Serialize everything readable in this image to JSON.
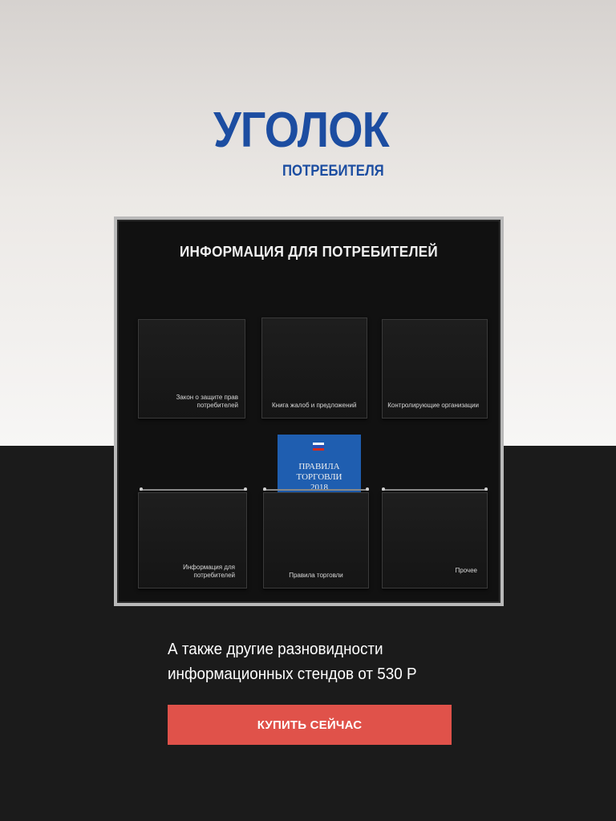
{
  "header": {
    "logo_title": "УГОЛОК",
    "logo_subtitle": "ПОТРЕБИТЕЛЯ"
  },
  "stand": {
    "title": "ИНФОРМАЦИЯ ДЛЯ ПОТРЕБИТЕЛЕЙ",
    "pockets_top": [
      {
        "label": "Закон о защите прав потребителей"
      },
      {
        "label": "Книга жалоб и предложений"
      },
      {
        "label": "Контролирующие организации"
      }
    ],
    "pockets_bottom": [
      {
        "label": "Информация для потребителей"
      },
      {
        "label": "Правила торговли"
      },
      {
        "label": "Прочее"
      }
    ],
    "booklet": {
      "line1": "ПРАВИЛА",
      "line2": "ТОРГОВЛИ",
      "line3": "2018"
    }
  },
  "promo": {
    "line1": "А также другие разновидности",
    "line2": "информационных стендов от 530 Р"
  },
  "cta": {
    "label": "КУПИТЬ СЕЙЧАС"
  },
  "colors": {
    "brand_blue": "#1c4da1",
    "button_red": "#e0524a",
    "dark_bg": "#1b1b1b"
  }
}
